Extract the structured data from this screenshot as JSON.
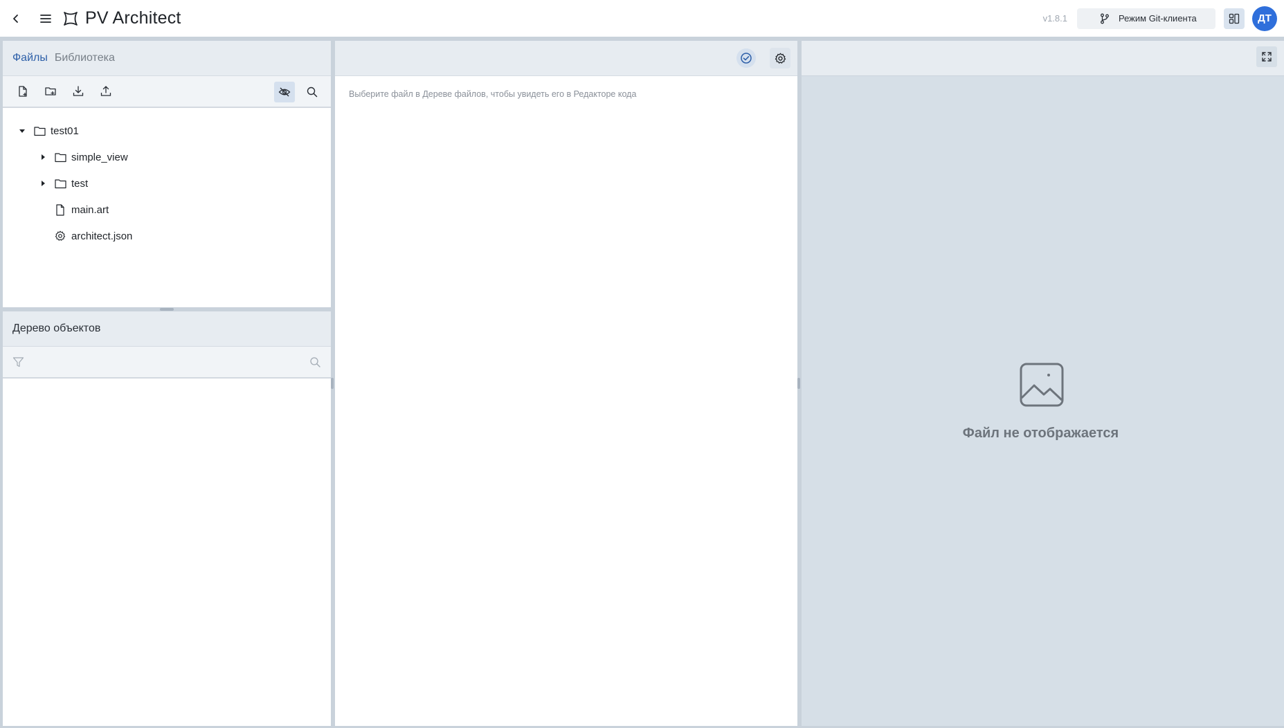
{
  "header": {
    "title": "PV Architect",
    "version": "v1.8.1",
    "git_mode_label": "Режим Git-клиента",
    "avatar_initials": "ДТ",
    "avatar_color": "#2f6fdb"
  },
  "files_panel": {
    "tabs": [
      {
        "label": "Файлы",
        "active": true
      },
      {
        "label": "Библиотека",
        "active": false
      }
    ],
    "toolbar_icons": [
      "new-file-icon",
      "new-folder-icon",
      "download-icon",
      "upload-icon",
      "hide-icon",
      "search-icon"
    ],
    "tree": [
      {
        "label": "test01",
        "type": "folder",
        "expanded": true,
        "level": 0
      },
      {
        "label": "simple_view",
        "type": "folder",
        "expanded": false,
        "level": 1
      },
      {
        "label": "test",
        "type": "folder",
        "expanded": false,
        "level": 1
      },
      {
        "label": "main.art",
        "type": "file",
        "level": 1
      },
      {
        "label": "architect.json",
        "type": "config",
        "level": 1
      }
    ]
  },
  "object_tree_panel": {
    "title": "Дерево объектов"
  },
  "editor": {
    "hint": "Выберите файл в Дереве файлов, чтобы увидеть его в Редакторе кода"
  },
  "preview": {
    "empty_text": "Файл не отображается"
  },
  "colors": {
    "accent": "#2d5fa8",
    "panel_header": "#e7ecf1",
    "preview_bg": "#d6dfe7"
  }
}
